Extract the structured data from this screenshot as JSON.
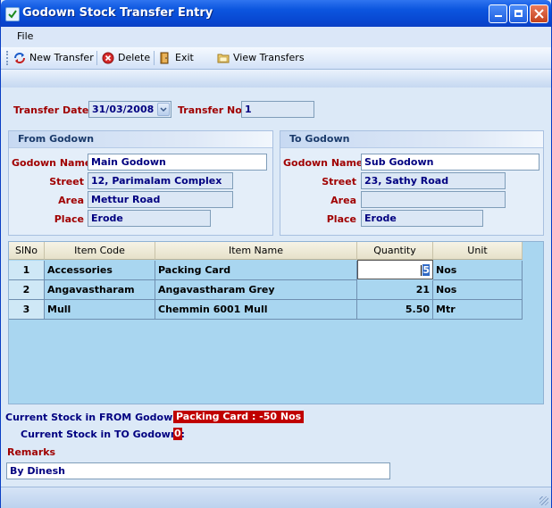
{
  "window": {
    "title": "Godown Stock Transfer Entry"
  },
  "menu": {
    "file": "File"
  },
  "toolbar": {
    "new_transfer": "New Transfer",
    "delete": "Delete",
    "exit": "Exit",
    "view_transfers": "View Transfers"
  },
  "header": {
    "transfer_date_label": "Transfer Date",
    "transfer_date": "31/03/2008",
    "transfer_no_label": "Transfer No",
    "transfer_no": "1"
  },
  "from_godown": {
    "title": "From Godown",
    "name_label": "Godown Name",
    "name": "Main Godown",
    "street_label": "Street",
    "street": "12, Parimalam Complex",
    "area_label": "Area",
    "area": "Mettur Road",
    "place_label": "Place",
    "place": "Erode"
  },
  "to_godown": {
    "title": "To Godown",
    "name_label": "Godown Name",
    "name": "Sub Godown",
    "street_label": "Street",
    "street": "23, Sathy Road",
    "area_label": "Area",
    "area": "",
    "place_label": "Place",
    "place": "Erode"
  },
  "grid": {
    "columns": [
      "SlNo",
      "Item Code",
      "Item Name",
      "Quantity",
      "Unit"
    ],
    "rows": [
      {
        "slno": "1",
        "code": "Accessories",
        "name": "Packing Card",
        "qty": "5",
        "unit": "Nos"
      },
      {
        "slno": "2",
        "code": "Angavastharam",
        "name": "Angavastharam Grey",
        "qty": "21",
        "unit": "Nos"
      },
      {
        "slno": "3",
        "code": "Mull",
        "name": "Chemmin 6001 Mull",
        "qty": "5.50",
        "unit": "Mtr"
      }
    ]
  },
  "stock": {
    "from_label": "Current Stock in FROM Godown :",
    "from_value": "Packing Card : -50 Nos",
    "to_label": "Current Stock in TO Godown :",
    "to_value": "0"
  },
  "remarks": {
    "label": "Remarks",
    "value": "By Dinesh"
  },
  "colors": {
    "title_bar": "#0c56df",
    "label_red": "#a00000",
    "value_navy": "#000080",
    "grid_bg": "#a9d6f0",
    "badge_red": "#c00000"
  }
}
